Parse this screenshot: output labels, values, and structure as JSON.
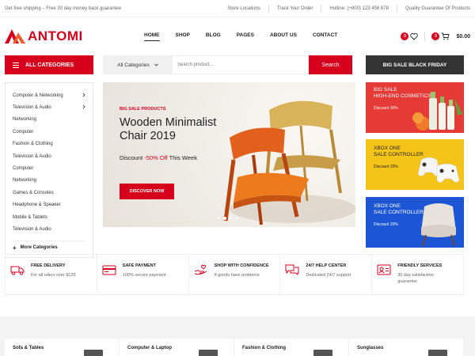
{
  "topbar": {
    "promo": "Get free shipping – Free 30 day money back guarantee",
    "links": [
      "Store Locations",
      "Track Your Order",
      "Hotline: (+800) 123 456 678",
      "Quality Guarantee Of Products"
    ]
  },
  "header": {
    "logo_text": "ANTOMI",
    "nav": [
      "HOME",
      "SHOP",
      "BLOG",
      "PAGES",
      "ABOUT US",
      "CONTACT"
    ],
    "wishlist_count": "0",
    "cart_count": "0",
    "cart_total": "$0.00"
  },
  "search": {
    "all_categories_label": "ALL CATEGORIES",
    "category_select": "All Categories",
    "placeholder": "Search product...",
    "button": "Search",
    "promo_button": "BIG SALE BLACK FRIDAY"
  },
  "categories": {
    "items": [
      {
        "label": "Computer & Networking",
        "arrow": true
      },
      {
        "label": "Television & Audio",
        "arrow": true
      },
      {
        "label": "Networking",
        "arrow": false
      },
      {
        "label": "Computer",
        "arrow": false
      },
      {
        "label": "Fashion & Clothing",
        "arrow": false
      },
      {
        "label": "Television & Audio",
        "arrow": false
      },
      {
        "label": "Computer",
        "arrow": false
      },
      {
        "label": "Networking",
        "arrow": false
      },
      {
        "label": "Games & Consoles",
        "arrow": false
      },
      {
        "label": "Headphone & Speaker",
        "arrow": false
      },
      {
        "label": "Mobile & Tablets",
        "arrow": false
      },
      {
        "label": "Television & Audio",
        "arrow": false
      }
    ],
    "more": "More Categories"
  },
  "hero": {
    "tag": "BIG SALE PRODUCTS",
    "title": "Wooden Minimalist Chair 2019",
    "discount_prefix": "Discount ",
    "discount_value": "-50% Off",
    "discount_suffix": " This Week",
    "cta": "DISCOVER NOW",
    "slide_count": 4,
    "active_slide": 2
  },
  "banners": [
    {
      "line1": "BIG SALE",
      "line2": "HIGH-END COSMETICS",
      "discount": "Discount 30%",
      "color": "#e53a36"
    },
    {
      "line1": "XBOX ONE",
      "line2": "SALE CONTROLLER",
      "discount": "Discount 20%",
      "color": "#f4c419"
    },
    {
      "line1": "XBOX ONE",
      "line2": "SALE CONTROLLER",
      "discount": "Discount 20%",
      "color": "#1c56d4"
    }
  ],
  "features": [
    {
      "title": "FREE DELIVERY",
      "desc": "For all oders over $120",
      "icon": "truck-icon"
    },
    {
      "title": "SAFE PAYMENT",
      "desc": "100% secure payment",
      "icon": "credit-card-icon"
    },
    {
      "title": "SHOP WITH CONFIDENCE",
      "desc": "If goods have problems",
      "icon": "hand-heart-icon"
    },
    {
      "title": "24/7 HELP CENTER",
      "desc": "Dedicated 24/7 support",
      "icon": "chat-icon"
    },
    {
      "title": "FRIENDLY SERVICES",
      "desc": "30 day satisfaction guarantee",
      "icon": "id-card-icon"
    }
  ],
  "bottom_cards": [
    "Sofa & Tables",
    "Computer & Laptop",
    "Fashion & Clothing",
    "Sunglasses"
  ],
  "colors": {
    "accent": "#d6001c",
    "dark": "#333333"
  }
}
